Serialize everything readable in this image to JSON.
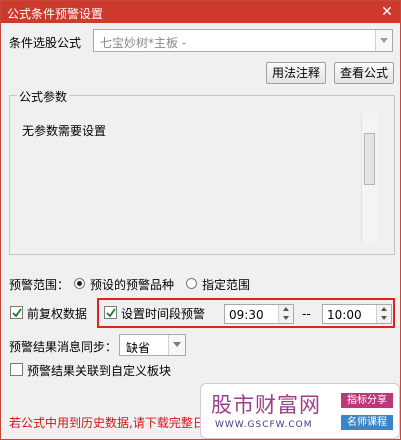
{
  "window": {
    "title": "公式条件预警设置",
    "close_icon": "close-icon"
  },
  "formula": {
    "label": "条件选股公式",
    "value": "七宝妙树*主板  -"
  },
  "buttons": {
    "usage_notes": "用法注释",
    "view_formula": "查看公式"
  },
  "params": {
    "group_title": "公式参数",
    "empty_text": "无参数需要设置"
  },
  "warning_range": {
    "label": "预警范围：",
    "option_preset": "预设的预警品种",
    "option_specified": "指定范围",
    "selected": "预设的预警品种"
  },
  "adjust": {
    "label": "前复权数据",
    "checked": true
  },
  "time_window": {
    "label": "设置时间段预警",
    "checked": true,
    "start": "09:30",
    "separator": "--",
    "end": "10:00"
  },
  "sync": {
    "label": "预警结果消息同步：",
    "value": "缺省"
  },
  "link_block": {
    "label": "预警结果关联到自定义板块",
    "checked": false
  },
  "footer_warning": "若公式中用到历史数据,请下载完整日",
  "watermark": {
    "brand": "股市财富网",
    "url": "WWW.GSCFW.COM",
    "tag1": "指标分享",
    "tag2": "名师课程",
    "tag1_color": "#c0367c",
    "tag2_color": "#3b86c8"
  },
  "colors": {
    "titlebar": "#cc3a2e",
    "highlight_border": "#e0221a",
    "warning_text": "#d2161b"
  }
}
